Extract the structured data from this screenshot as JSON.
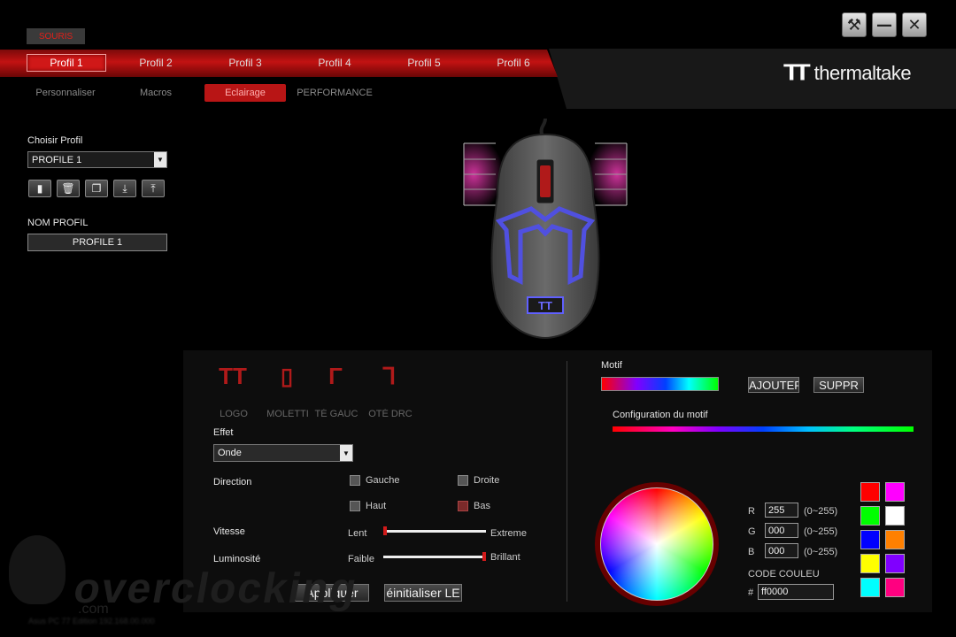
{
  "window": {
    "section_tab": "SOURIS",
    "brand_logo": "TT",
    "brand_name": "thermaltake",
    "buttons": {
      "tools": "⚒",
      "minimize": "—",
      "close": "✕"
    }
  },
  "profiles": [
    "Profil 1",
    "Profil 2",
    "Profil 3",
    "Profil 4",
    "Profil 5",
    "Profil 6"
  ],
  "subtabs": [
    "Personnaliser",
    "Macros",
    "Eclairage",
    "PERFORMANCE"
  ],
  "left": {
    "choose_label": "Choisir Profil",
    "choose_value": "PROFILE 1",
    "name_label": "NOM PROFIL",
    "name_value": "PROFILE 1",
    "icon_buttons": [
      "save-icon",
      "trash-icon",
      "copy-icon",
      "import-icon",
      "export-icon"
    ]
  },
  "lighting": {
    "zone_glyphs": [
      "TT",
      "▯",
      "Γ",
      "Ꞁ"
    ],
    "zones": [
      "LOGO",
      "MOLETTE",
      "CÔTÉ GAUCHE",
      "CÔTÉ DROIT"
    ],
    "zones_visible": [
      "LOGO",
      "MOLETTI",
      "TÉ GAUC",
      "OTÉ DRC"
    ],
    "effect_label": "Effet",
    "effect_value": "Onde",
    "direction_label": "Direction",
    "directions": {
      "left": "Gauche",
      "right": "Droite",
      "up": "Haut",
      "down": "Bas"
    },
    "speed_label": "Vitesse",
    "speed_min": "Lent",
    "speed_max": "Extreme",
    "speed_value": 0,
    "brightness_label": "Luminosité",
    "brightness_min": "Faible",
    "brightness_max": "Brillant",
    "brightness_value": 1,
    "apply": "Appliquer",
    "reset": "éinitialiser LE"
  },
  "motif": {
    "label": "Motif",
    "add": "AJOUTEF",
    "delete": "SUPPR",
    "config_label": "Configuration du motif"
  },
  "color": {
    "r_label": "R",
    "g_label": "G",
    "b_label": "B",
    "r": "255",
    "g": "000",
    "b": "000",
    "range": "(0~255)",
    "code_label": "CODE COULEU",
    "hash": "#",
    "code": "ff0000",
    "swatches": [
      "#ff0000",
      "#ff00ff",
      "#00ff00",
      "#ffffff",
      "#0000ff",
      "#ff8000",
      "#ffff00",
      "#8000ff",
      "#00ffff",
      "#ff0080"
    ]
  },
  "watermark": {
    "main": "overclocking",
    "sub": ".com",
    "caption": "Asus PC 77 Edition 192.168.00.000"
  }
}
